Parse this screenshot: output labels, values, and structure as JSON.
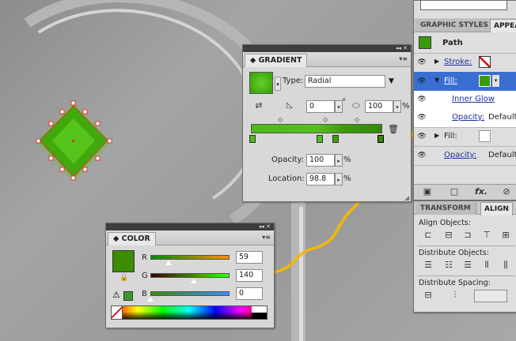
{
  "canvas": {
    "shape_color": "#41a80d",
    "anchor_color": "#d23c2a",
    "arrow_color": "#f4b800"
  },
  "gradient_panel": {
    "title": "GRADIENT",
    "type_label": "Type:",
    "type_value": "Radial",
    "angle_value": "0",
    "degree_symbol": "°",
    "aspect_value": "100",
    "aspect_unit": "%",
    "opacity_label": "Opacity:",
    "opacity_value": "100",
    "opacity_unit": "%",
    "location_label": "Location:",
    "location_value": "98.8",
    "location_unit": "%",
    "stops_count_colors": [
      "#4fb81a",
      "#56bf1f",
      "#3e9c0c",
      "#2f8a05"
    ]
  },
  "color_panel": {
    "title": "COLOR",
    "swatch_color": "#3b8c00",
    "r_label": "R",
    "r_value": "59",
    "g_label": "G",
    "g_value": "140",
    "b_label": "B",
    "b_value": "0",
    "r_level": 0.23,
    "g_level": 0.55,
    "b_level": 0.0
  },
  "appearance_panel": {
    "tab_graphic_styles": "GRAPHIC STYLES",
    "tab_appearance": "APPEA",
    "path_label": "Path",
    "stroke_label": "Stroke:",
    "fill_label": "Fill:",
    "inner_glow": "Inner Glow",
    "opacity_label": "Opacity:",
    "opacity_value": "Default",
    "fill2_label": "Fill:",
    "opacity2_label": "Opacity:",
    "opacity2_value": "Default",
    "fx_label": "fx."
  },
  "transform_panel": {
    "tab_transform": "TRANSFORM",
    "tab_align": "ALIGN",
    "align_objects": "Align Objects:",
    "distribute_objects": "Distribute Objects:",
    "distribute_spacing": "Distribute Spacing:"
  }
}
